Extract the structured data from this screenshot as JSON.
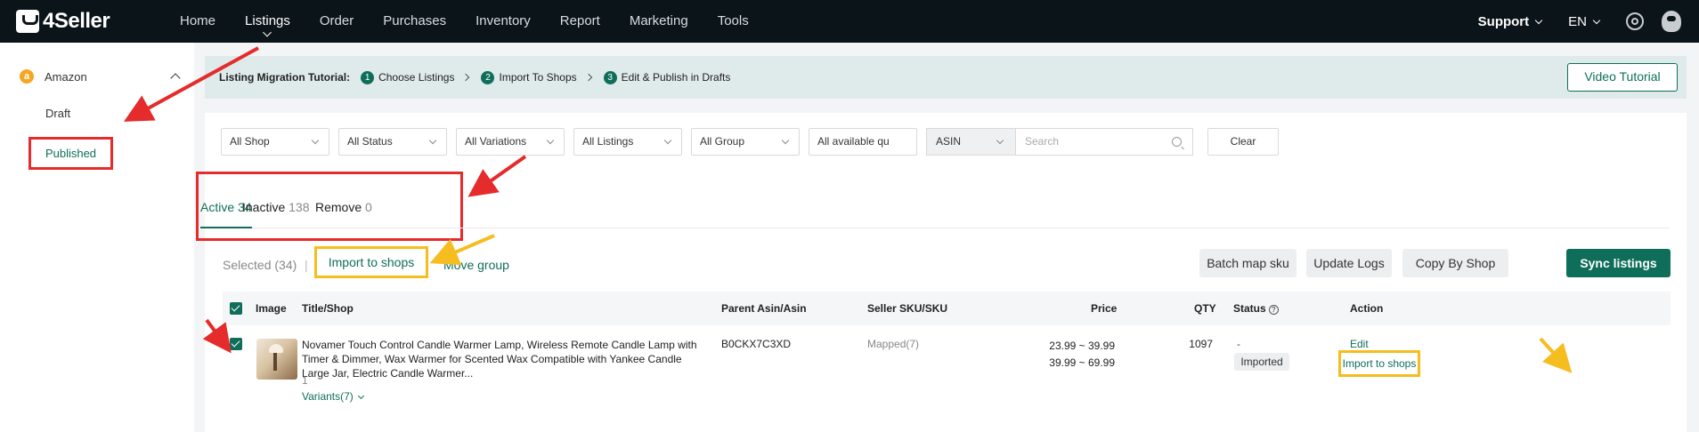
{
  "brand": {
    "name": "4Seller"
  },
  "nav": {
    "items": [
      "Home",
      "Listings",
      "Order",
      "Purchases",
      "Inventory",
      "Report",
      "Marketing",
      "Tools"
    ],
    "active": "Listings"
  },
  "topright": {
    "support": "Support",
    "language": "EN"
  },
  "sidebar": {
    "marketplace": "Amazon",
    "marketplace_icon": "a",
    "items": [
      "Draft",
      "Published"
    ],
    "active": "Published"
  },
  "tutorial": {
    "title": "Listing Migration Tutorial:",
    "steps": [
      {
        "num": "1",
        "label": "Choose Listings"
      },
      {
        "num": "2",
        "label": "Import To Shops"
      },
      {
        "num": "3",
        "label": "Edit & Publish in Drafts"
      }
    ],
    "video_button": "Video Tutorial"
  },
  "filters": {
    "selects": [
      "All Shop",
      "All Status",
      "All Variations",
      "All Listings",
      "All Group",
      "All available qu"
    ],
    "search_type": "ASIN",
    "search_placeholder": "Search",
    "clear": "Clear"
  },
  "tabs": [
    {
      "label": "Active",
      "count": "34"
    },
    {
      "label": "Inactive",
      "count": "138"
    },
    {
      "label": "Remove",
      "count": "0"
    }
  ],
  "actions": {
    "selected": "Selected (34)",
    "separator": "|",
    "import_to_shops": "Import to shops",
    "move_group": "Move group",
    "batch_map_sku": "Batch map sku",
    "update_logs": "Update Logs",
    "copy_by_shop": "Copy By Shop",
    "sync_listings": "Sync listings"
  },
  "table": {
    "columns": {
      "image": "Image",
      "title": "Title/Shop",
      "asin": "Parent Asin/Asin",
      "sku": "Seller SKU/SKU",
      "price": "Price",
      "qty": "QTY",
      "status": "Status",
      "action": "Action"
    },
    "rows": [
      {
        "title": "Novamer Touch Control Candle Warmer Lamp, Wireless Remote Candle Lamp with Timer & Dimmer, Wax Warmer for Scented Wax Compatible with Yankee Candle Large Jar, Electric Candle Warmer...",
        "shop_count": "1",
        "variants": "Variants(7)",
        "asin": "B0CKX7C3XD",
        "sku": "Mapped(7)",
        "price_1": "23.99 ~ 39.99",
        "price_2": "39.99 ~ 69.99",
        "qty": "1097",
        "status_dash": "-",
        "status": "Imported",
        "action_edit": "Edit",
        "action_import": "Import to shops"
      }
    ]
  },
  "colors": {
    "brand_green": "#0f6e5a",
    "highlight_red": "#e52b2b",
    "highlight_yellow": "#f5bd1f",
    "topbar": "#0b1418"
  }
}
